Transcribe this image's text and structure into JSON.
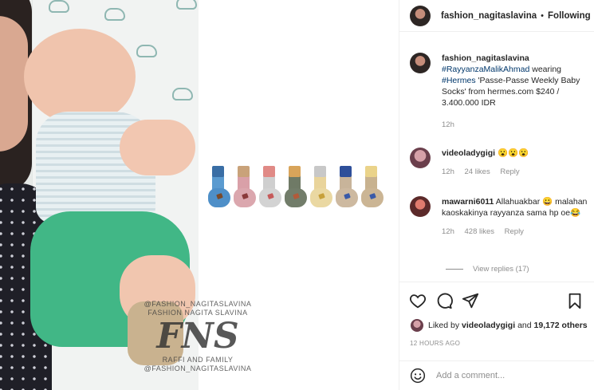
{
  "photo": {
    "watermark_top": "@FASHION_NAGITASLAVINA",
    "watermark_name": "FASHION NAGITA SLAVINA",
    "watermark_logo": "FNS",
    "watermark_family": "RAFFI AND FAMILY",
    "watermark_bottom": "@FASHION_NAGITASLAVINA"
  },
  "product": {
    "socks": [
      {
        "cuff": "#3a6ea5",
        "body": "#5b9bd0",
        "foot": "#4e8fc8",
        "mark": "#7a4a2a"
      },
      {
        "cuff": "#c9a27a",
        "body": "#d9a0a8",
        "foot": "#dba7ae",
        "mark": "#8a3a3a"
      },
      {
        "cuff": "#e08a86",
        "body": "#cfcfcf",
        "foot": "#d3d3d3",
        "mark": "#c65a5a"
      },
      {
        "cuff": "#d8a45a",
        "body": "#6f7a66",
        "foot": "#727d6a",
        "mark": "#b25a3a"
      },
      {
        "cuff": "#c8c8c8",
        "body": "#e9d49b",
        "foot": "#ead8a2",
        "mark": "#c7a03a"
      },
      {
        "cuff": "#2e4f9a",
        "body": "#c8b49a",
        "foot": "#cdb9a0",
        "mark": "#3a5aa8"
      },
      {
        "cuff": "#ead38a",
        "body": "#c8b28f",
        "foot": "#cbb594",
        "mark": "#3a5aa8"
      }
    ]
  },
  "header": {
    "username": "fashion_nagitaslavina",
    "separator": "•",
    "follow_status": "Following"
  },
  "caption": {
    "username": "fashion_nagitaslavina",
    "hashtag1": "#RayyanzaMalikAhmad",
    "text1": " wearing ",
    "hashtag2": "#Hermes",
    "text2": " 'Passe-Passe Weekly Baby Socks' from hermes.com $240 / 3.400.000 IDR",
    "time": "12h"
  },
  "comments": [
    {
      "username": "videoladygigi",
      "text": "😮😮😮",
      "time": "12h",
      "likes": "24 likes",
      "reply": "Reply"
    },
    {
      "username": "mawarni6011",
      "text": "Allahuakbar 😀 malahan kaoskakinya rayyanza sama hp oe😂",
      "time": "12h",
      "likes": "428 likes",
      "reply": "Reply"
    }
  ],
  "view_replies": "View replies (17)",
  "liked_by": {
    "prefix": "Liked by ",
    "user": "videoladygigi",
    "middle": " and ",
    "others": "19,172 others"
  },
  "timestamp": "12 HOURS AGO",
  "add_comment": {
    "placeholder": "Add a comment..."
  }
}
